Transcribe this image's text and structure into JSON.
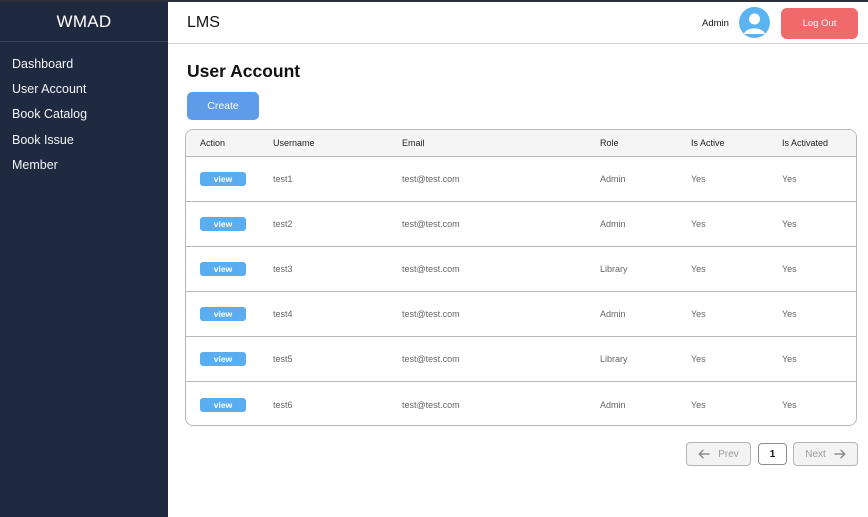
{
  "sidebar": {
    "brand": "WMAD",
    "items": [
      {
        "label": "Dashboard"
      },
      {
        "label": "User Account"
      },
      {
        "label": "Book Catalog"
      },
      {
        "label": "Book Issue"
      },
      {
        "label": "Member"
      }
    ]
  },
  "header": {
    "app_title": "LMS",
    "user_name": "Admin",
    "logout_label": "Log Out"
  },
  "main": {
    "title": "User Account",
    "create_label": "Create",
    "table": {
      "columns": [
        "Action",
        "Username",
        "Email",
        "Role",
        "Is Active",
        "Is Activated"
      ],
      "rows": [
        {
          "action": "view",
          "username": "test1",
          "email": "test@test.com",
          "role": "Admin",
          "is_active": "Yes",
          "is_activated": "Yes"
        },
        {
          "action": "view",
          "username": "test2",
          "email": "test@test.com",
          "role": "Admin",
          "is_active": "Yes",
          "is_activated": "Yes"
        },
        {
          "action": "view",
          "username": "test3",
          "email": "test@test.com",
          "role": "Library",
          "is_active": "Yes",
          "is_activated": "Yes"
        },
        {
          "action": "view",
          "username": "test4",
          "email": "test@test.com",
          "role": "Admin",
          "is_active": "Yes",
          "is_activated": "Yes"
        },
        {
          "action": "view",
          "username": "test5",
          "email": "test@test.com",
          "role": "Library",
          "is_active": "Yes",
          "is_activated": "Yes"
        },
        {
          "action": "view",
          "username": "test6",
          "email": "test@test.com",
          "role": "Admin",
          "is_active": "Yes",
          "is_activated": "Yes"
        }
      ]
    }
  },
  "pagination": {
    "prev_label": "Prev",
    "page": "1",
    "next_label": "Next"
  },
  "colors": {
    "sidebar_bg": "#1f2a40",
    "logout": "#f0696b",
    "primary": "#5e9be9",
    "view_button": "#5aaef0",
    "avatar": "#5ab4f2"
  },
  "icons": {
    "avatar": "user-avatar-icon",
    "prev": "arrow-left-icon",
    "next": "arrow-right-icon"
  }
}
